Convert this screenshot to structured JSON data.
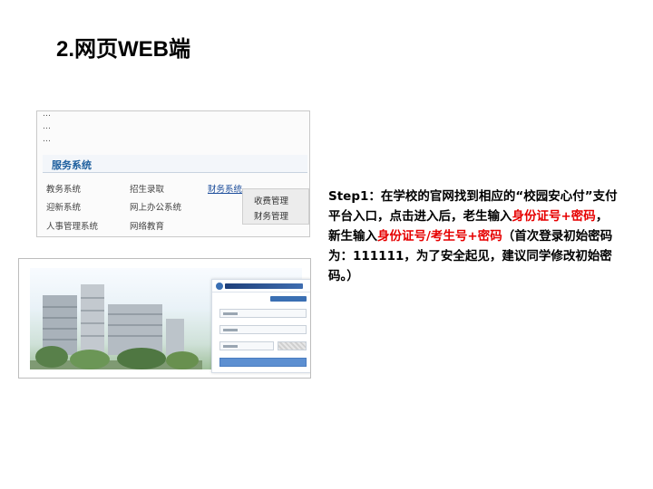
{
  "slide": {
    "title": "2.网页WEB端"
  },
  "portal_screenshot": {
    "news_lines": [
      "...",
      "...",
      "..."
    ],
    "service_section": {
      "title": "服务系统",
      "items": [
        {
          "label": "教务系统"
        },
        {
          "label": "招生录取"
        },
        {
          "label": "财务系统"
        },
        {
          "label": "迎新系统"
        },
        {
          "label": "网上办公系统"
        },
        {
          "label": "人事管理系统"
        },
        {
          "label": "网络教育"
        }
      ],
      "finance_menu": [
        "收费管理",
        "财务管理"
      ]
    }
  },
  "step": {
    "part1": "Step1：在学校的官网找到相应的“校园安心付”支付平台入口，点击进入后，老生输入",
    "hl1": "身份证号+密码",
    "part2": "，新生输入",
    "hl2": "身份证号/考生号+密码",
    "part3": "（首次登录初始密码为：111111，为了安全起见，建议同学修改初始密码。）",
    "highlight_color": "#e60000"
  }
}
